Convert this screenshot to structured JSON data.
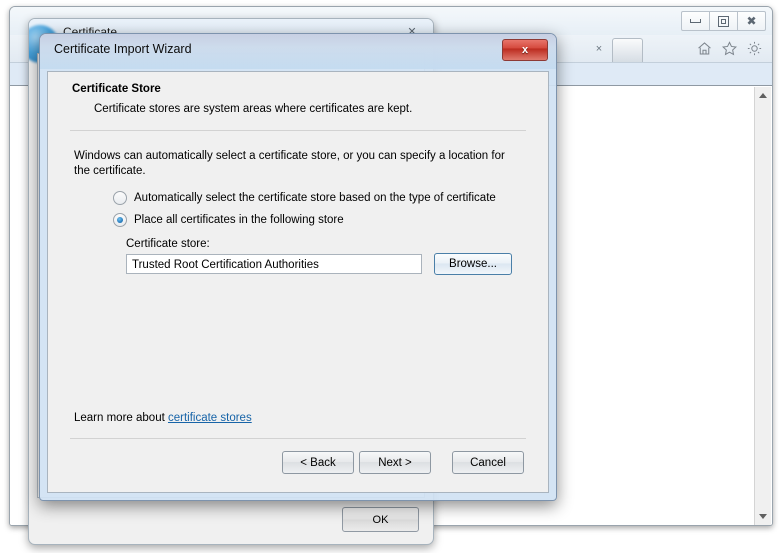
{
  "browser": {
    "window_controls": {
      "minimize": "minimize-icon",
      "maximize": "maximize-icon",
      "close": "close-icon"
    },
    "tab_close_label": "×",
    "toolbar_icons": [
      "home-icon",
      "favorites-star-icon",
      "settings-gear-icon"
    ],
    "scrollbar": {
      "up_arrow": "scroll-up-arrow",
      "down_arrow": "scroll-down-arrow"
    }
  },
  "certificate_dialog": {
    "title": "Certificate",
    "close_label": "✕",
    "ok_label": "OK"
  },
  "wizard": {
    "title": "Certificate Import Wizard",
    "close_label": "x",
    "header": {
      "title": "Certificate Store",
      "subtitle": "Certificate stores are system areas where certificates are kept."
    },
    "intro": "Windows can automatically select a certificate store, or you can specify a location for the certificate.",
    "options": [
      {
        "label": "Automatically select the certificate store based on the type of certificate",
        "selected": false
      },
      {
        "label": "Place all certificates in the following store",
        "selected": true
      }
    ],
    "store_label": "Certificate store:",
    "store_value": "Trusted Root Certification Authorities",
    "browse_label": "Browse...",
    "learn_more_prefix": "Learn more about ",
    "learn_more_link": "certificate stores",
    "buttons": {
      "back": "< Back",
      "next": "Next >",
      "cancel": "Cancel"
    }
  },
  "colors": {
    "accent_blue": "#1764a8",
    "close_red": "#bb2a1e",
    "radio_blue": "#2b7fc0",
    "address_bar": "#dfeaf6"
  }
}
